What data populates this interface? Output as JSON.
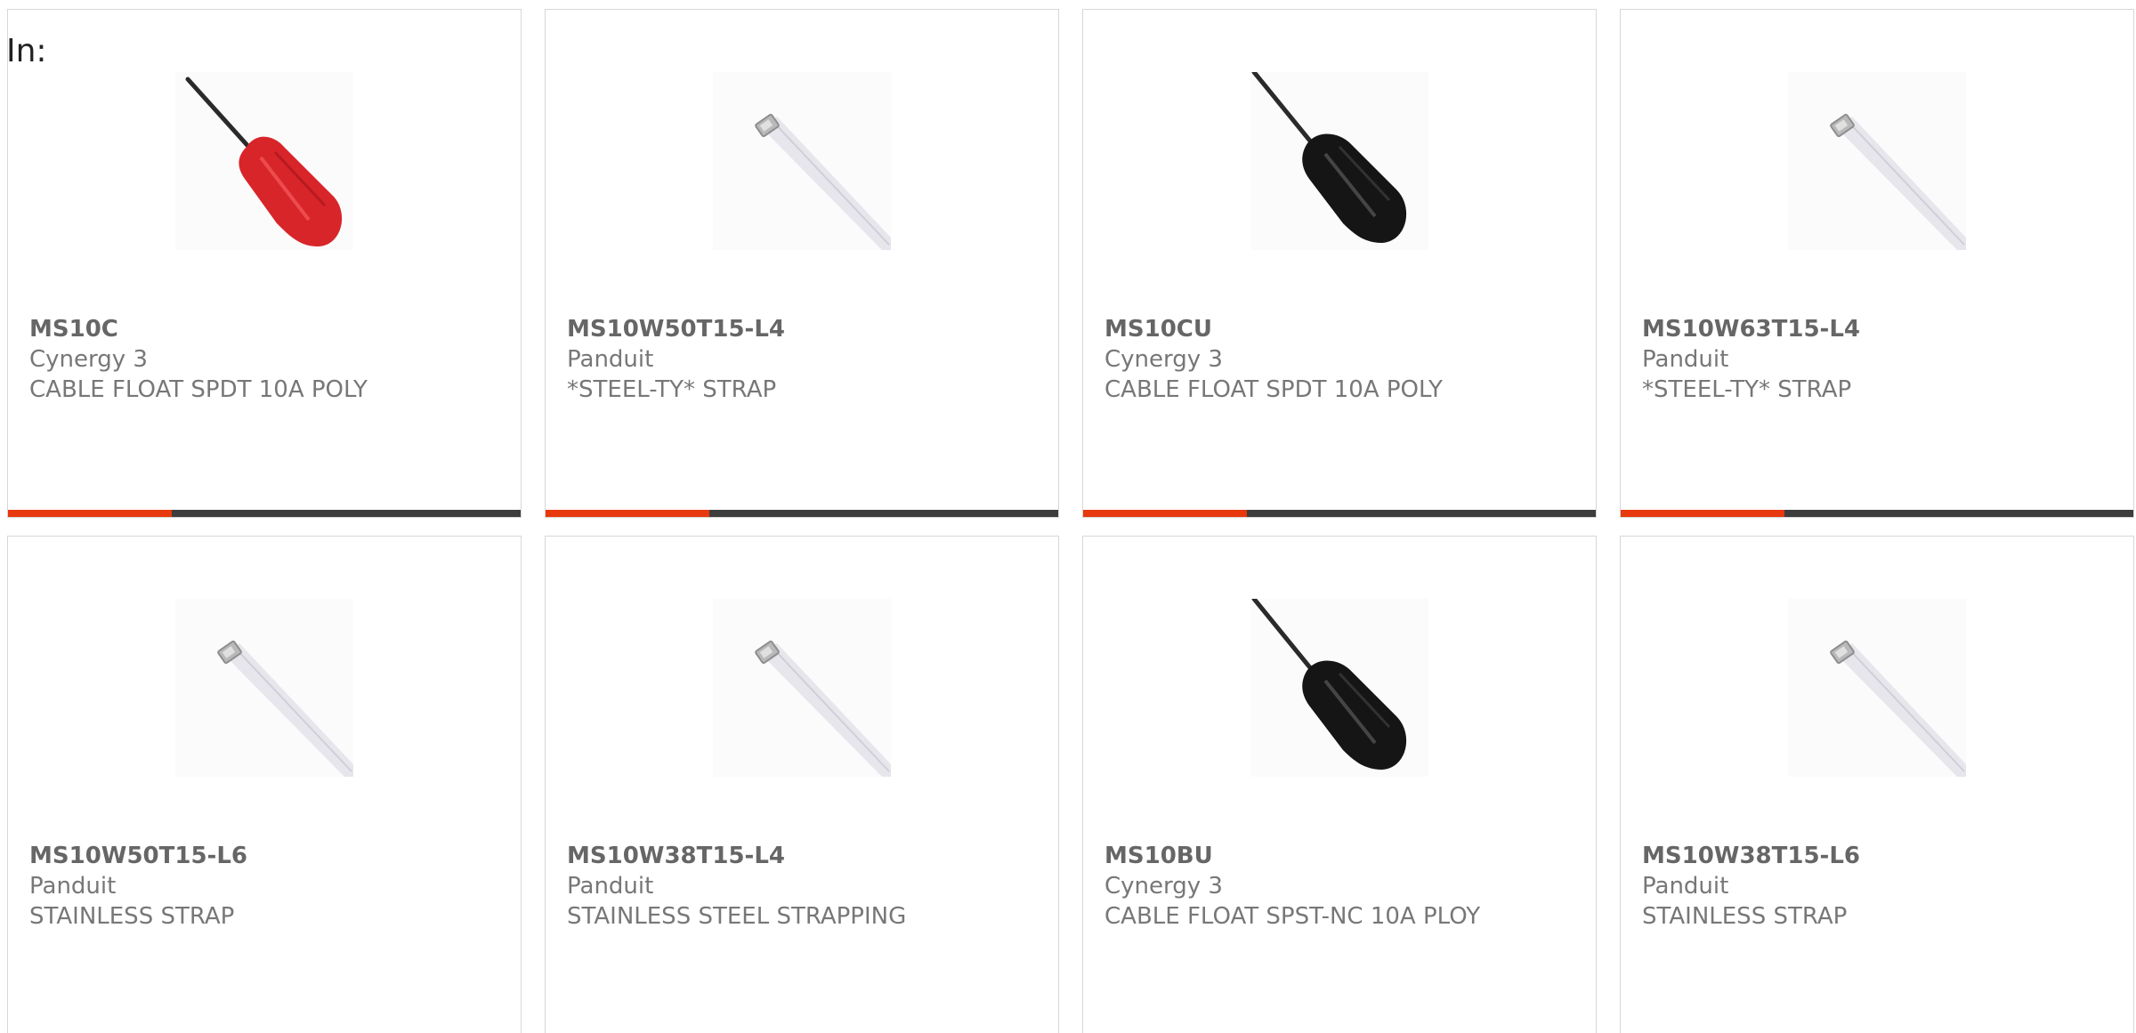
{
  "header": {
    "label": "In:"
  },
  "colors": {
    "accent": "#e8380d",
    "bar": "#3d3d3d",
    "red_handle": "#d8252a",
    "black_handle": "#151515",
    "strap": "#e6e6ec"
  },
  "products": [
    {
      "sku": "MS10C",
      "brand": "Cynergy 3",
      "description": "CABLE FLOAT SPDT 10A POLY",
      "image_icon": "red-float-switch-icon",
      "progress_fraction": 0.32
    },
    {
      "sku": "MS10W50T15-L4",
      "brand": "Panduit",
      "description": "*STEEL-TY* STRAP",
      "image_icon": "steel-strap-icon",
      "progress_fraction": 0.32
    },
    {
      "sku": "MS10CU",
      "brand": "Cynergy 3",
      "description": "CABLE FLOAT SPDT 10A POLY",
      "image_icon": "black-float-switch-icon",
      "progress_fraction": 0.32
    },
    {
      "sku": "MS10W63T15-L4",
      "brand": "Panduit",
      "description": "*STEEL-TY* STRAP",
      "image_icon": "steel-strap-icon",
      "progress_fraction": 0.32
    },
    {
      "sku": "MS10W50T15-L6",
      "brand": "Panduit",
      "description": "STAINLESS STRAP",
      "image_icon": "steel-strap-icon"
    },
    {
      "sku": "MS10W38T15-L4",
      "brand": "Panduit",
      "description": "STAINLESS STEEL STRAPPING",
      "image_icon": "steel-strap-icon"
    },
    {
      "sku": "MS10BU",
      "brand": "Cynergy 3",
      "description": "CABLE FLOAT SPST-NC 10A PLOY",
      "image_icon": "black-float-switch-icon"
    },
    {
      "sku": "MS10W38T15-L6",
      "brand": "Panduit",
      "description": "STAINLESS STRAP",
      "image_icon": "steel-strap-icon"
    }
  ]
}
